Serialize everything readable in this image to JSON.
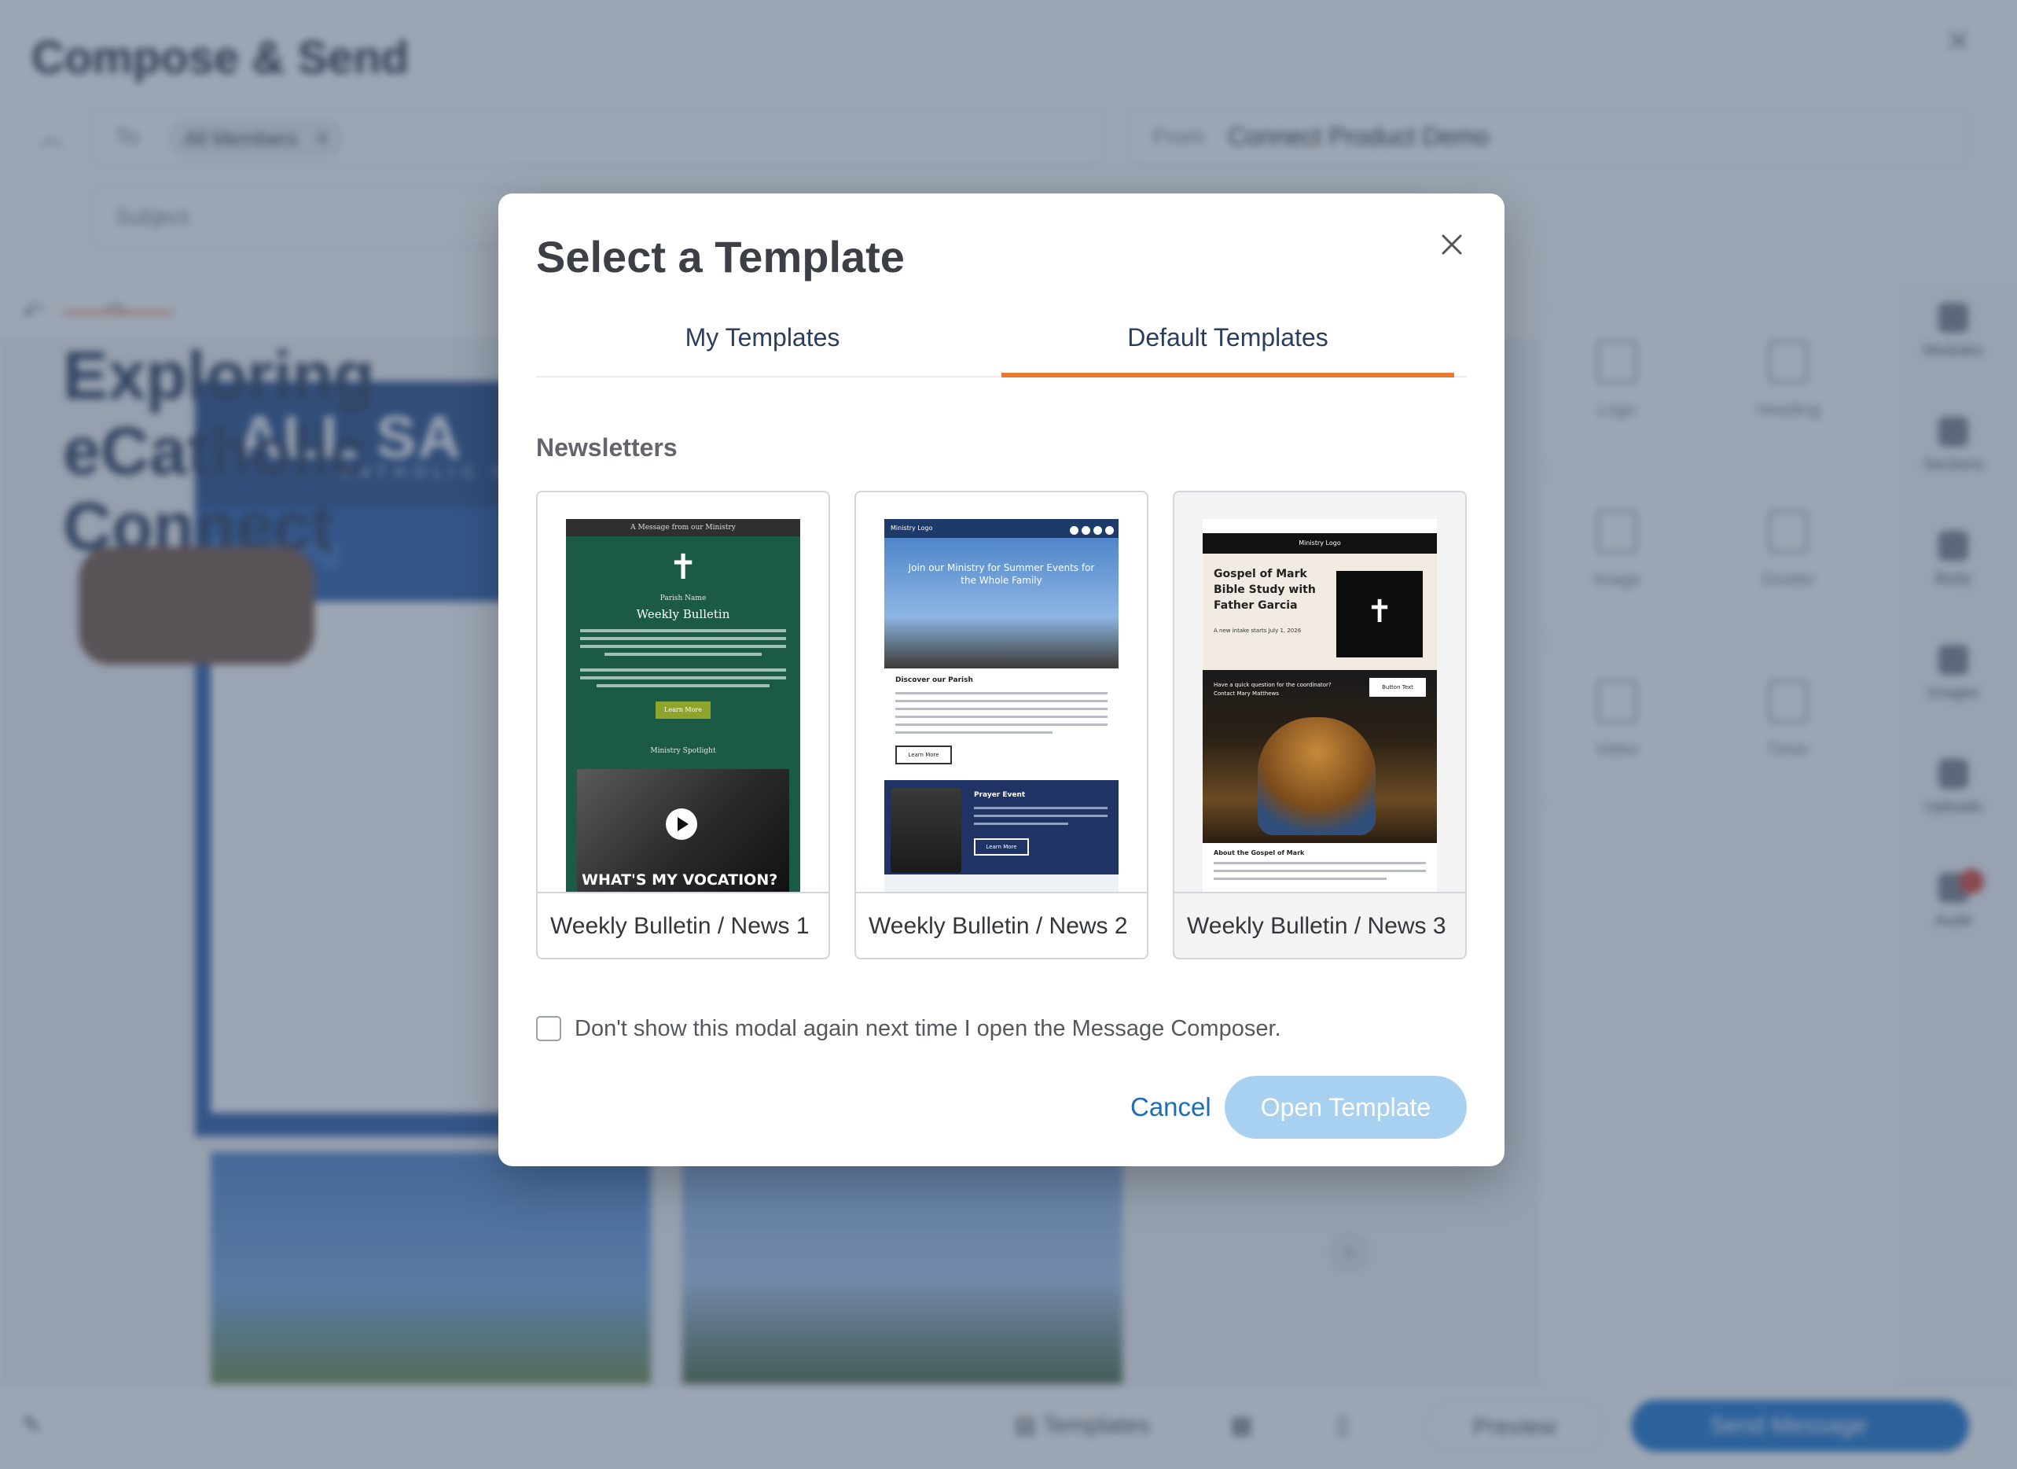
{
  "background": {
    "title": "Compose & Send",
    "to_label": "To",
    "to_chip": "All Members",
    "from_label": "From",
    "from_value": "Connect Product Demo",
    "subject_placeholder": "Subject",
    "email_preview": {
      "logo_text": "ALL SA",
      "logo_sub": "CATHOLIC CH",
      "heading": "Heading",
      "headline": "Exploring eCatholic Connect"
    },
    "blocks": [
      "Logo",
      "Heading",
      "Image",
      "Divider",
      "Video",
      "Timer"
    ],
    "rail": [
      "Modules",
      "Sections",
      "Body",
      "Images",
      "Uploads",
      "Audit"
    ],
    "bottom": {
      "templates": "Templates",
      "preview": "Preview",
      "send": "Send Message"
    }
  },
  "modal": {
    "title": "Select a Template",
    "tabs": [
      {
        "label": "My Templates",
        "active": false
      },
      {
        "label": "Default Templates",
        "active": true
      }
    ],
    "section_label": "Newsletters",
    "templates": [
      {
        "name": "Weekly Bulletin / News 1",
        "selected": false
      },
      {
        "name": "Weekly Bulletin / News 2",
        "selected": false
      },
      {
        "name": "Weekly Bulletin / News 3",
        "selected": true
      }
    ],
    "previews": {
      "t1": {
        "top": "A Message from our Ministry",
        "parish": "Parish Name",
        "title": "Weekly Bulletin",
        "button": "Learn More",
        "spotlight": "Ministry Spotlight",
        "video_text": "WHAT'S MY VOCATION?"
      },
      "t2": {
        "logo": "Ministry Logo",
        "hero": "Join our Ministry for Summer Events for the Whole Family",
        "section": "Discover our Parish",
        "button": "Learn More",
        "event": "Prayer Event",
        "event_button": "Learn More"
      },
      "t3": {
        "logo": "Ministry Logo",
        "title": "Gospel of Mark Bible Study with Father Garcia",
        "date": "A new intake starts July 1, 2026",
        "question": "Have a quick question for the coordinator? Contact Mary Matthews",
        "button": "Button Text",
        "about": "About the Gospel of Mark"
      }
    },
    "dont_show_label": "Don't show this modal again next time I open the Message Composer.",
    "dont_show_checked": false,
    "cancel_label": "Cancel",
    "open_label": "Open Template",
    "colors": {
      "tab_accent": "#e87a2f",
      "primary_disabled": "#a8d0f0",
      "link": "#1c6fb7"
    }
  }
}
